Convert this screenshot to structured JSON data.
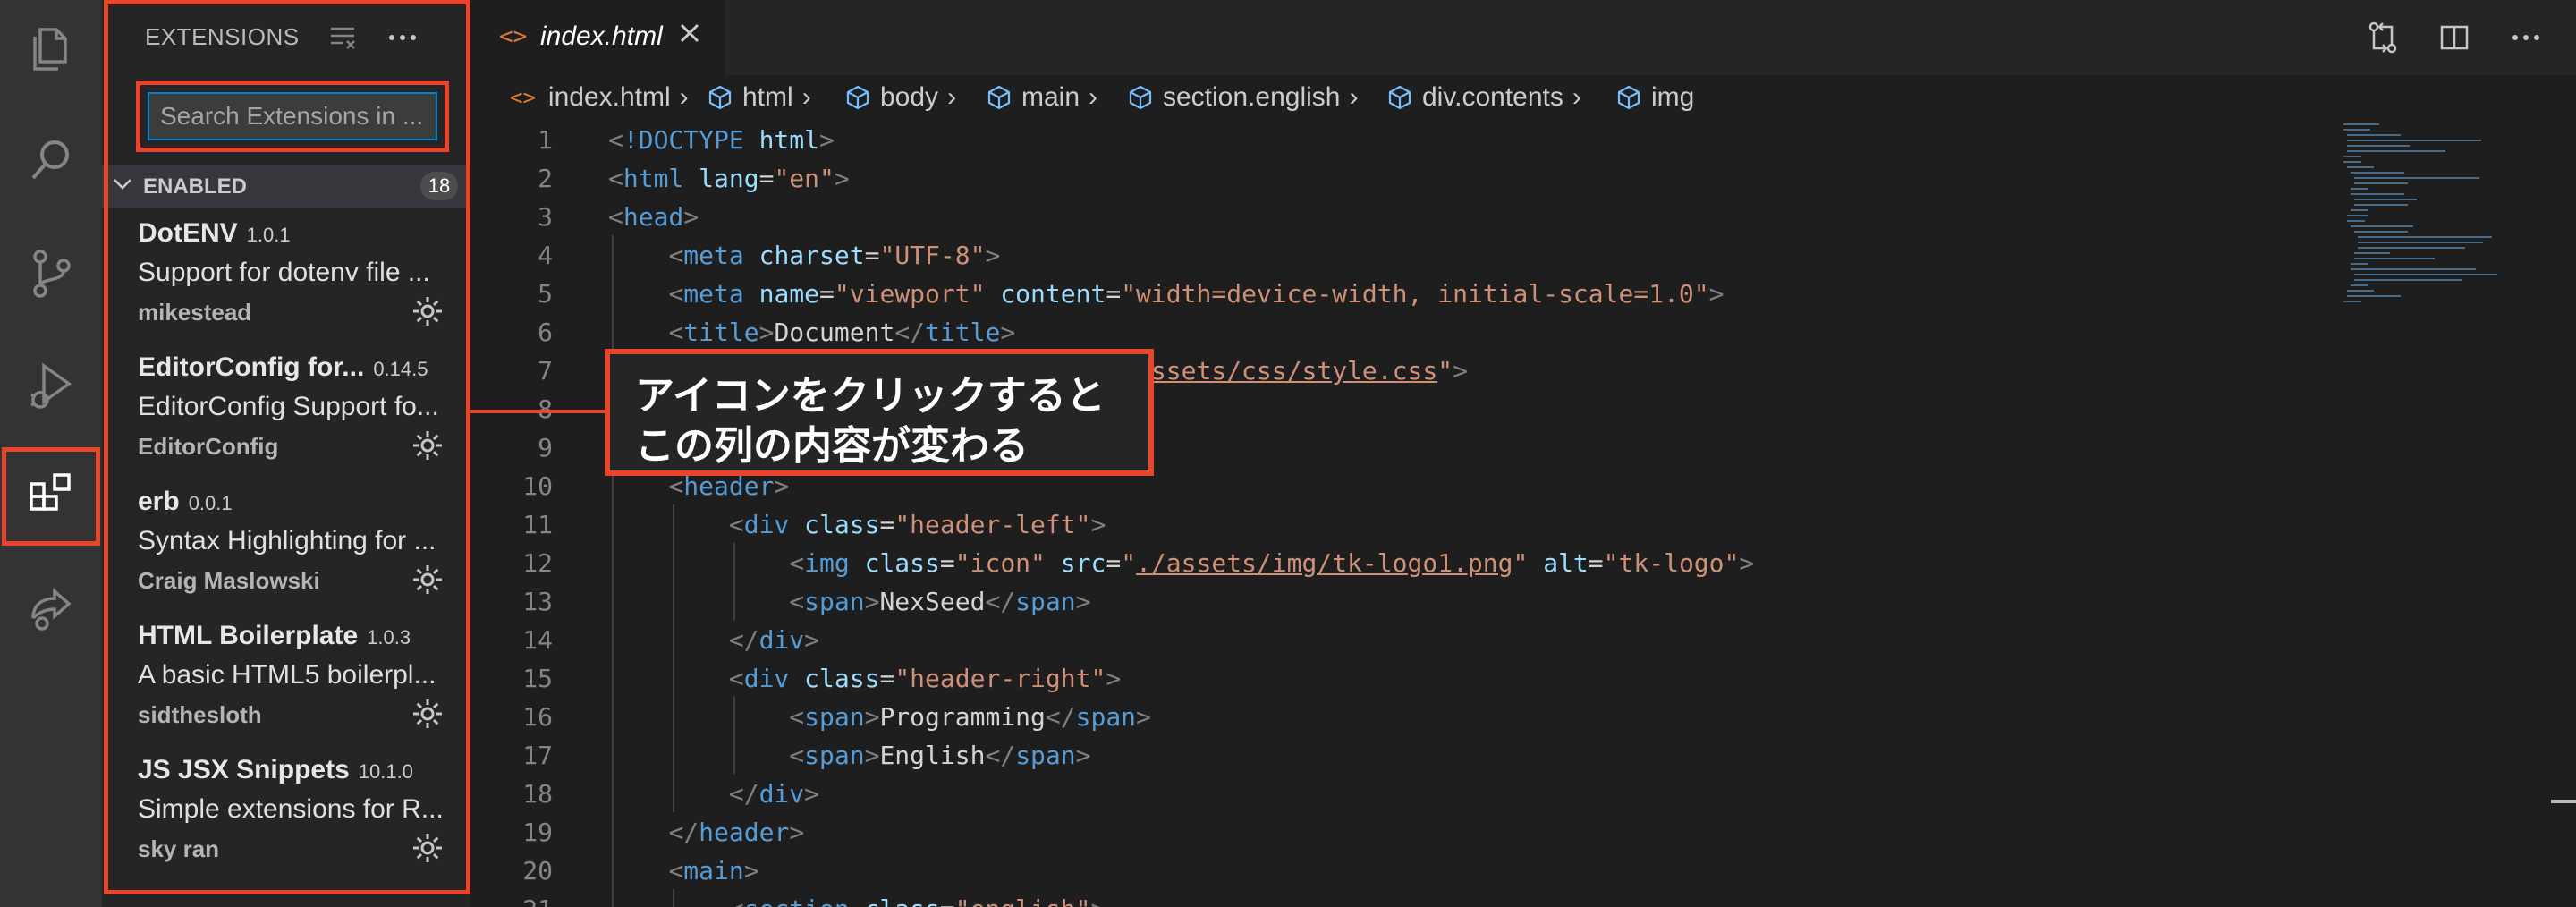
{
  "activity_bar": {
    "items": [
      {
        "icon": "files-icon"
      },
      {
        "icon": "search-icon"
      },
      {
        "icon": "source-control-icon"
      },
      {
        "icon": "run-debug-icon"
      },
      {
        "icon": "extensions-icon",
        "active": true
      },
      {
        "icon": "remote-share-icon"
      }
    ]
  },
  "sidebar": {
    "title": "EXTENSIONS",
    "search_placeholder": "Search Extensions in ...",
    "section_label": "ENABLED",
    "section_count": "18",
    "extensions": [
      {
        "name": "DotENV",
        "version": "1.0.1",
        "description": "Support for dotenv file ...",
        "publisher": "mikestead"
      },
      {
        "name": "EditorConfig for...",
        "version": "0.14.5",
        "description": "EditorConfig Support fo...",
        "publisher": "EditorConfig"
      },
      {
        "name": "erb",
        "version": "0.0.1",
        "description": "Syntax Highlighting for ...",
        "publisher": "Craig Maslowski"
      },
      {
        "name": "HTML Boilerplate",
        "version": "1.0.3",
        "description": "A basic HTML5 boilerpl...",
        "publisher": "sidthesloth"
      },
      {
        "name": "JS JSX Snippets",
        "version": "10.1.0",
        "description": "Simple extensions for R...",
        "publisher": "sky ran"
      }
    ]
  },
  "editor": {
    "tab_label": "index.html",
    "breadcrumb": [
      "index.html",
      "html",
      "body",
      "main",
      "section.english",
      "div.contents",
      "img"
    ],
    "line_numbers": [
      "1",
      "2",
      "3",
      "4",
      "5",
      "6",
      "7",
      "8",
      "9",
      "10",
      "11",
      "12",
      "13",
      "14",
      "15",
      "16",
      "17",
      "18",
      "19",
      "20",
      "21"
    ]
  },
  "callout": {
    "line1": "アイコンをクリックすると",
    "line2": "この列の内容が変わる"
  },
  "colors": {
    "highlight": "#e8462a",
    "tag": "#569cd6",
    "attribute": "#9cdcfe",
    "string": "#ce9178"
  }
}
